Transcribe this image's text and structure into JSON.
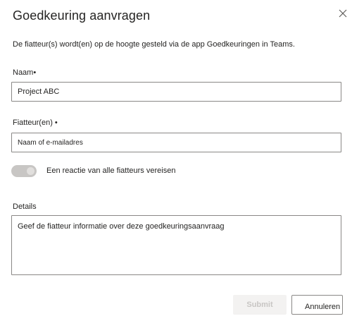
{
  "dialog": {
    "title": "Goedkeuring aanvragen",
    "close_icon": "close-icon",
    "description": "De fiatteur(s) wordt(en) op de hoogte gesteld via de app Goedkeuringen in Teams."
  },
  "form": {
    "name": {
      "label": "Naam•",
      "value": "Project ABC"
    },
    "approvers": {
      "label": "Fiatteur(en) •",
      "placeholder": "Naam of e-mailadres"
    },
    "require_all": {
      "label": "Een reactie van alle fiatteurs vereisen",
      "state": "off"
    },
    "details": {
      "label": "Details",
      "placeholder": "Geef de fiatteur informatie over deze goedkeuringsaanvraag"
    }
  },
  "actions": {
    "submit_label": "Submit",
    "cancel_label": "Annuleren"
  }
}
